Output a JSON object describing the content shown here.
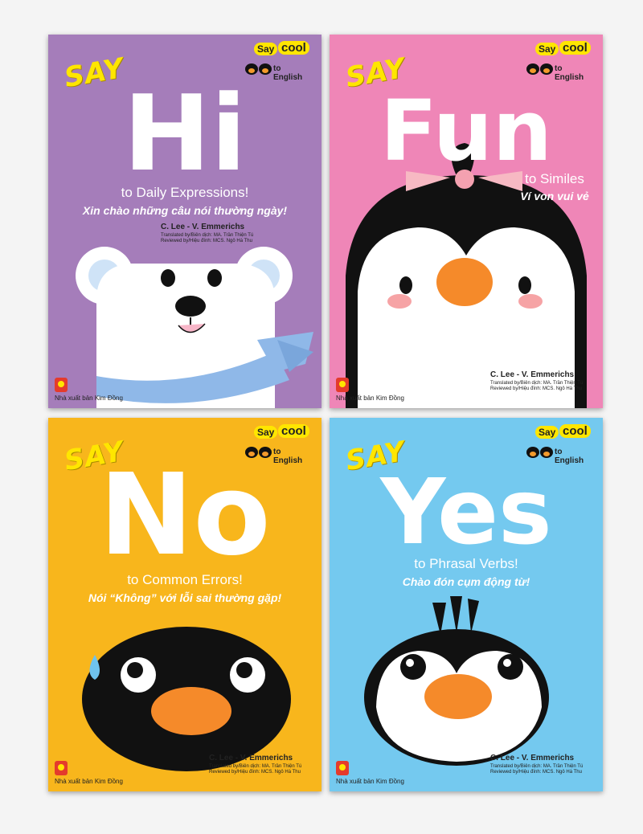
{
  "series": {
    "say": "Say",
    "cool": "cool",
    "to_english": "to English"
  },
  "covers": [
    {
      "say": "SAY",
      "word": "Hi",
      "subtitle": "to Daily Expressions!",
      "vietnamese": "Xin chào những câu nói thường ngày!",
      "authors": "C. Lee - V. Emmerichs",
      "translated": "Translated by/Biên dịch: MA. Trần Thiện Tú",
      "reviewed": "Reviewed by/Hiệu đính: MCS. Ngô Hà Thu",
      "publisher": "Nhà xuất bản Kim Đồng",
      "background": "#a57dba"
    },
    {
      "say": "SAY",
      "word": "Fun",
      "subtitle": "to Similes",
      "vietnamese": "Ví von vui vẻ",
      "authors": "C. Lee - V. Emmerichs",
      "translated": "Translated by/Biên dịch: MA. Trần Thiện Tú",
      "reviewed": "Reviewed by/Hiệu đính: MCS. Ngô Hà Thu",
      "publisher": "Nhà xuất bản Kim Đồng",
      "background": "#ef86b7"
    },
    {
      "say": "SAY",
      "word": "No",
      "subtitle": "to Common Errors!",
      "vietnamese": "Nói “Không” với lỗi sai thường gặp!",
      "authors": "C. Lee - V. Emmerichs",
      "translated": "Translated by/Biên dịch: MA. Trần Thiện Tú",
      "reviewed": "Reviewed by/Hiệu đính: MCS. Ngô Hà Thu",
      "publisher": "Nhà xuất bản Kim Đồng",
      "background": "#f8b61c"
    },
    {
      "say": "SAY",
      "word": "Yes",
      "subtitle": "to Phrasal Verbs!",
      "vietnamese": "Chào đón cụm động từ!",
      "authors": "C. Lee - V. Emmerichs",
      "translated": "Translated by/Biên dịch: MA. Trần Thiện Tú",
      "reviewed": "Reviewed by/Hiệu đính: MCS. Ngô Hà Thu",
      "publisher": "Nhà xuất bản Kim Đồng",
      "background": "#74c9ef"
    }
  ]
}
